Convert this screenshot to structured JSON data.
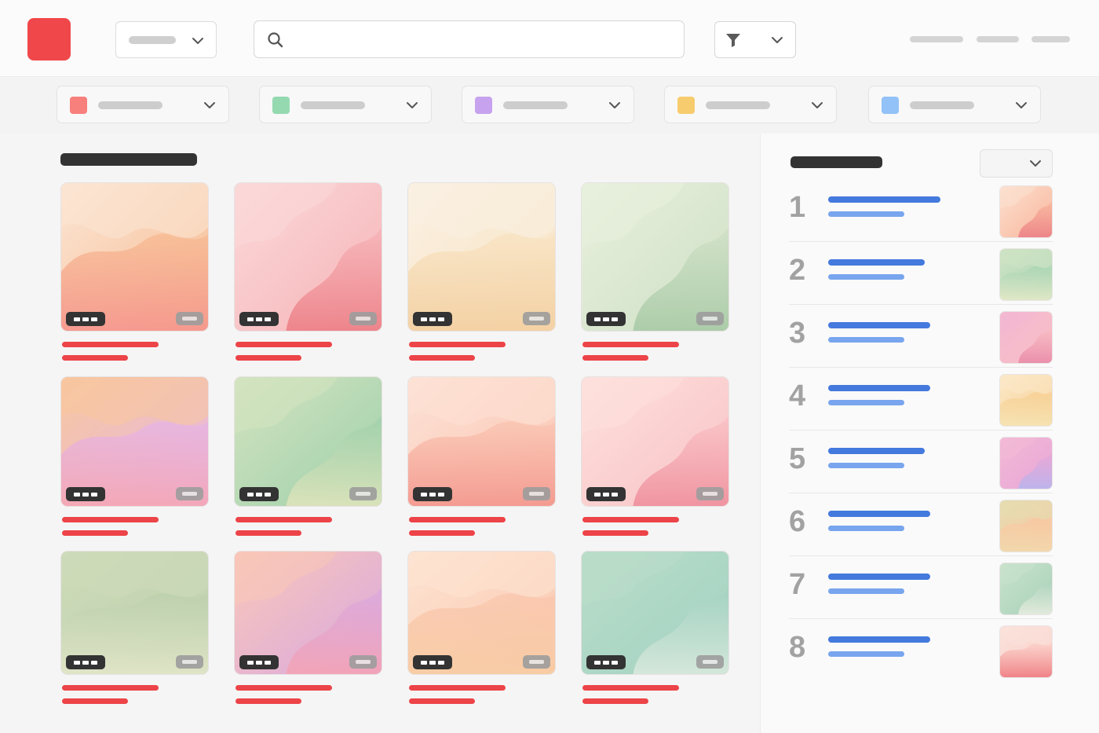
{
  "colors": {
    "brand": "#f0474a",
    "title_bar": "#333333",
    "card_caption": "#ec4448",
    "rank_line_primary": "#4479dd",
    "rank_line_secondary": "#78a5ee",
    "rank_number": "#a2a2a2"
  },
  "header": {
    "logo": "brand-logo",
    "category_select": {
      "value": ""
    },
    "search": {
      "placeholder": "",
      "value": "",
      "icon": "search-icon"
    },
    "filter": {
      "icon": "funnel-icon",
      "dropdown_icon": "chevron-down-icon"
    },
    "nav_links": [
      "",
      "",
      ""
    ]
  },
  "category_filters": [
    {
      "swatch": "#f77f7c",
      "label": ""
    },
    {
      "swatch": "#94d9b0",
      "label": ""
    },
    {
      "swatch": "#c7a2ee",
      "label": ""
    },
    {
      "swatch": "#f7cc6e",
      "label": ""
    },
    {
      "swatch": "#92c2f7",
      "label": ""
    }
  ],
  "main": {
    "section_title": "",
    "cards": [
      {
        "palette": [
          "#f7bb92",
          "#f5958d",
          "#fbe5d3"
        ],
        "title": "",
        "subtitle": ""
      },
      {
        "palette": [
          "#f6b4b8",
          "#ec7f86",
          "#fbd8d8"
        ],
        "title": "",
        "subtitle": ""
      },
      {
        "palette": [
          "#f8e3c2",
          "#f3cfa0",
          "#faf0e2"
        ],
        "title": "",
        "subtitle": ""
      },
      {
        "palette": [
          "#cfe0c6",
          "#a8caa6",
          "#e8f0dd"
        ],
        "title": "",
        "subtitle": ""
      },
      {
        "palette": [
          "#e5b5e6",
          "#f5a6b4",
          "#f8c79f"
        ],
        "title": "",
        "subtitle": ""
      },
      {
        "palette": [
          "#9dd0ab",
          "#dfe4bb",
          "#d4e3c0"
        ],
        "title": "",
        "subtitle": ""
      },
      {
        "palette": [
          "#fac5b2",
          "#f3968d",
          "#fde1d5"
        ],
        "title": "",
        "subtitle": ""
      },
      {
        "palette": [
          "#f9c2c5",
          "#ef8f9d",
          "#fde0dc"
        ],
        "title": "",
        "subtitle": ""
      },
      {
        "palette": [
          "#bcd0ad",
          "#e2e6c8",
          "#cedbb9"
        ],
        "title": "",
        "subtitle": ""
      },
      {
        "palette": [
          "#d9a8e0",
          "#f4a3b4",
          "#f9c7b8"
        ],
        "title": "",
        "subtitle": ""
      },
      {
        "palette": [
          "#fac6ae",
          "#f8cca3",
          "#fde4d2"
        ],
        "title": "",
        "subtitle": ""
      },
      {
        "palette": [
          "#a3d2c2",
          "#d9e9dd",
          "#b9ddc9"
        ],
        "title": "",
        "subtitle": ""
      }
    ]
  },
  "sidebar": {
    "title": "",
    "sort_select": {
      "value": ""
    },
    "ranking": [
      {
        "rank": "1",
        "palette": [
          "#f9b59b",
          "#ec7f86",
          "#fce0cf"
        ],
        "title": "",
        "subtitle": ""
      },
      {
        "rank": "2",
        "palette": [
          "#a8d5b4",
          "#e5e9c8",
          "#cfe3c4"
        ],
        "title": "",
        "subtitle": ""
      },
      {
        "rank": "3",
        "palette": [
          "#f9bfc4",
          "#e98aa8",
          "#f3b8d2"
        ],
        "title": "",
        "subtitle": ""
      },
      {
        "rank": "4",
        "palette": [
          "#f7cf93",
          "#f6e4b4",
          "#fbe8c8"
        ],
        "title": "",
        "subtitle": ""
      },
      {
        "rank": "5",
        "palette": [
          "#e8a6d7",
          "#b8b5ee",
          "#f2b9d6"
        ],
        "title": "",
        "subtitle": ""
      },
      {
        "rank": "6",
        "palette": [
          "#f9c6a1",
          "#f2d9ad",
          "#e6ddb1"
        ],
        "title": "",
        "subtitle": ""
      },
      {
        "rank": "7",
        "palette": [
          "#a9d2ba",
          "#e8ede0",
          "#c8e2cc"
        ],
        "title": "",
        "subtitle": ""
      },
      {
        "rank": "8",
        "palette": [
          "#fbd0c8",
          "#ef7a80",
          "#fae1db"
        ],
        "title": "",
        "subtitle": ""
      }
    ]
  }
}
